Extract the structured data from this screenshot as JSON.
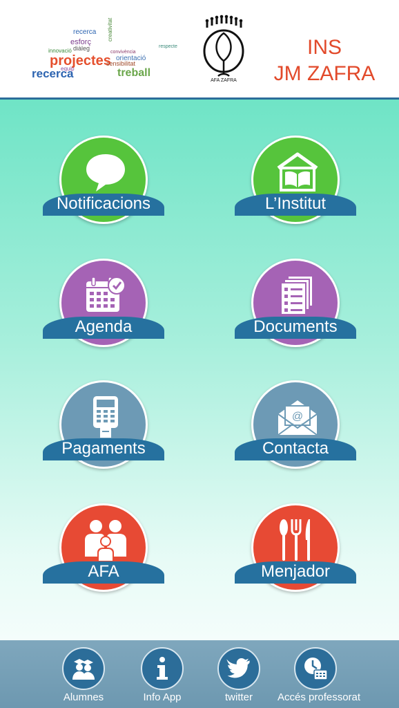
{
  "header": {
    "wordcloud": [
      "recerca",
      "esforç",
      "projectes",
      "innovació",
      "equip",
      "treball",
      "sensibilitat",
      "orientació",
      "creativitat",
      "diàleg",
      "convivència",
      "respecte",
      "recerca"
    ],
    "afa_logo_text": "AFA ZAFRA",
    "school_line1": "INS",
    "school_line2": "JM ZAFRA"
  },
  "tiles": [
    {
      "label": "Notificacions",
      "color": "#56c43c",
      "icon": "speech-bubble-icon"
    },
    {
      "label": "L’Institut",
      "color": "#56c43c",
      "icon": "school-book-icon"
    },
    {
      "label": "Agenda",
      "color": "#a563b5",
      "icon": "calendar-icon"
    },
    {
      "label": "Documents",
      "color": "#a563b5",
      "icon": "documents-icon"
    },
    {
      "label": "Pagaments",
      "color": "#6d9ab5",
      "icon": "payment-terminal-icon"
    },
    {
      "label": "Contacta",
      "color": "#6d9ab5",
      "icon": "envelope-icon"
    },
    {
      "label": "AFA",
      "color": "#e74a34",
      "icon": "family-icon"
    },
    {
      "label": "Menjador",
      "color": "#e74a34",
      "icon": "cutlery-icon"
    }
  ],
  "footer": [
    {
      "label": "Alumnes",
      "icon": "students-icon"
    },
    {
      "label": "Info App",
      "icon": "info-icon"
    },
    {
      "label": "twitter",
      "icon": "twitter-bird-icon"
    },
    {
      "label": "Accés professorat",
      "icon": "teacher-access-icon"
    }
  ],
  "colors": {
    "accent_blue": "#26719f",
    "school_red": "#e24a2b",
    "footer_bg": "#7fa7bd"
  }
}
